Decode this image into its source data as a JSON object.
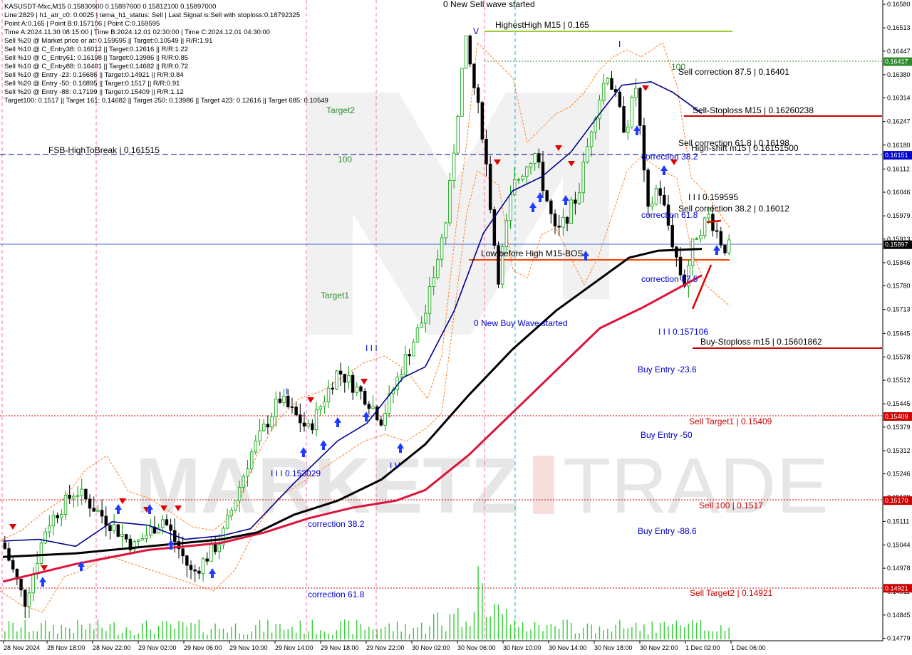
{
  "header": {
    "lines": [
      "KASUSDT-Mxc,M15  0.15830900 0.15897600 0.15812100 0.15897000",
      "Line:2829  |  h1_atr_c0: 0.0025  |  tema_h1_status: Sell  |  Last Signal is:Sell with stoploss:0.18792325",
      "Point A:0.165  |  Point B:0.157106  |  Point C:0.159595",
      "Time A:2024.11.30 08:15:00  |  Time B:2024.12.01 02:30:00  |  Time C:2024.12.01 04:30:00",
      "Sell %20 @ Market price or at: 0.159595  ||  Target:0.10549  ||  R/R:1.91",
      "Sell %10 @ C_Entry38: 0.16012  ||  Target:0.12616  ||  R/R:1.22",
      "Sell %10 @ C_Entry61: 0.16198  ||  Target:0.13986  ||  R/R:0.85",
      "Sell %10 @ C_Entry88: 0.16401  ||  Target:0.14682  ||  R/R:0.72",
      "Sell %10 @ Entry -23: 0.16686  ||  Target:0.14921  ||  R/R:0.84",
      "Sell %20 @ Entry -50: 0.16895  ||  Target:0.1517  ||  R/R:0.91",
      "Sell %20 @ Entry -88: 0.17199  ||  Target:0.15409  ||  R/R:1.12",
      "Target100: 0.1517  ||  Target 161: 0.14682  ||  Target 250: 0.13986  ||  Target 423: 0.12616  ||  Target 685: 0.10549"
    ]
  },
  "watermark": {
    "text_left": "MARKETZ",
    "text_right": "TRADE"
  },
  "colors": {
    "blue_ma": "#00008b",
    "black_ma": "#000000",
    "red_ma": "#dc143c",
    "candle_up": "#00a000",
    "candle_down": "#000000",
    "price_line": "#4169e1",
    "red_level": "#cc0000",
    "green_level": "#9acd32"
  },
  "annotations": [
    {
      "id": "new-sell-wave",
      "text": "0 New Sell wave started",
      "color": "black"
    },
    {
      "id": "highest-high",
      "text": "HighestHigh   M15 | 0.165",
      "color": "black"
    },
    {
      "id": "v-mark",
      "text": "V",
      "color": "blue"
    },
    {
      "id": "i-mark-top",
      "text": "I",
      "color": "blue"
    },
    {
      "id": "hundred-top",
      "text": "100",
      "color": "green"
    },
    {
      "id": "sell-corr-875",
      "text": "Sell correction 87.5 | 0.16401",
      "color": "black"
    },
    {
      "id": "sell-stoploss",
      "text": "Sell-Stoploss M15 | 0.16260238",
      "color": "black"
    },
    {
      "id": "sell-corr-618",
      "text": "Sell correction 61.8 | 0.16198",
      "color": "black"
    },
    {
      "id": "high-shift",
      "text": "High-shift m15 | 0.16151500",
      "color": "black"
    },
    {
      "id": "target2",
      "text": "Target2",
      "color": "green"
    },
    {
      "id": "fsb",
      "text": "FSB-HighToBreak | 0.161515",
      "color": "black"
    },
    {
      "id": "hundred-mid",
      "text": "100",
      "color": "green"
    },
    {
      "id": "corr-382-top",
      "text": "correction 38.2",
      "color": "blue"
    },
    {
      "id": "point-c",
      "text": "I I I 0.159595",
      "color": "black"
    },
    {
      "id": "sell-corr-382",
      "text": "Sell correction 38.2 | 0.16012",
      "color": "black"
    },
    {
      "id": "corr-618-top",
      "text": "correction 61.8",
      "color": "blue"
    },
    {
      "id": "low-before-high",
      "text": "Low before High   M15-BOS",
      "color": "black"
    },
    {
      "id": "corr-875",
      "text": "correction 87.5",
      "color": "blue"
    },
    {
      "id": "target1",
      "text": "Target1",
      "color": "green"
    },
    {
      "id": "new-buy-wave",
      "text": "0 New Buy Wave started",
      "color": "blue"
    },
    {
      "id": "point-b",
      "text": "I I I 0.157106",
      "color": "blue"
    },
    {
      "id": "buy-stoploss",
      "text": "Buy-Stoploss m15 | 0.15601862",
      "color": "black"
    },
    {
      "id": "buy-entry-236",
      "text": "Buy Entry -23.6",
      "color": "blue"
    },
    {
      "id": "iii-mark",
      "text": "I I I",
      "color": "blue"
    },
    {
      "id": "i-mark-left",
      "text": "I",
      "color": "blue"
    },
    {
      "id": "sell-target1",
      "text": "Sell Target1 | 0.15409",
      "color": "red"
    },
    {
      "id": "buy-entry-50",
      "text": "Buy Entry -50",
      "color": "blue"
    },
    {
      "id": "iv-mark",
      "text": "I V",
      "color": "blue"
    },
    {
      "id": "point-low",
      "text": "I I I 0.153029",
      "color": "blue"
    },
    {
      "id": "sell-100",
      "text": "Sell 100 | 0.1517",
      "color": "red"
    },
    {
      "id": "corr-382-low",
      "text": "correction 38.2",
      "color": "blue"
    },
    {
      "id": "buy-entry-886",
      "text": "Buy Entry -88.6",
      "color": "blue"
    },
    {
      "id": "corr-618-low",
      "text": "correction 61.8",
      "color": "blue"
    },
    {
      "id": "sell-target2",
      "text": "Sell Target2 | 0.14921",
      "color": "red"
    }
  ],
  "chart_data": {
    "type": "candlestick",
    "symbol": "KASUSDT-Mxc",
    "timeframe": "M15",
    "ylim": [
      0.1478,
      0.1658
    ],
    "y_ticks": [
      "0.16580",
      "0.16513",
      "0.16447",
      "0.16380",
      "0.16314",
      "0.16247",
      "0.16180",
      "0.16112",
      "0.16046",
      "0.15979",
      "0.15913",
      "0.15846",
      "0.15780",
      "0.15713",
      "0.15645",
      "0.15578",
      "0.15512",
      "0.15445",
      "0.15379",
      "0.15312",
      "0.15246",
      "0.15179",
      "0.15111",
      "0.15044",
      "0.14978",
      "0.14911",
      "0.14845",
      "0.14779"
    ],
    "x_ticks": [
      "28 Nov 2024",
      "28 Nov 18:00",
      "28 Nov 22:00",
      "29 Nov 02:00",
      "29 Nov 06:00",
      "29 Nov 10:00",
      "29 Nov 14:00",
      "29 Nov 18:00",
      "29 Nov 22:00",
      "30 Nov 02:00",
      "30 Nov 06:00",
      "30 Nov 10:00",
      "30 Nov 14:00",
      "30 Nov 18:00",
      "30 Nov 22:00",
      "1 Dec 02:00",
      "1 Dec 06:00"
    ],
    "price_tags": [
      {
        "value": 0.16417,
        "text": "0.16417",
        "color": "#2e8b2e"
      },
      {
        "value": 0.16151,
        "text": "0.16151",
        "color": "#0000cd"
      },
      {
        "value": 0.15897,
        "text": "0.15897",
        "color": "#000000"
      },
      {
        "value": 0.15409,
        "text": "0.15409",
        "color": "#cc0000"
      },
      {
        "value": 0.1517,
        "text": "0.15170",
        "color": "#cc0000"
      },
      {
        "value": 0.14921,
        "text": "0.14921",
        "color": "#cc0000"
      }
    ],
    "levels": [
      {
        "name": "highest-high",
        "value": 0.165,
        "color": "#9acd32",
        "style": "solid"
      },
      {
        "name": "sell-correction-87.5",
        "value": 0.16417,
        "color": "#2e8b2e",
        "style": "dotted"
      },
      {
        "name": "sell-stoploss",
        "value": 0.1626,
        "color": "#cc0000",
        "style": "solid"
      },
      {
        "name": "fsb-high-to-break",
        "value": 0.16151,
        "color": "#00008b",
        "style": "dashed"
      },
      {
        "name": "current-price",
        "value": 0.15897,
        "color": "#4169e1",
        "style": "solid"
      },
      {
        "name": "low-before-high",
        "value": 0.15855,
        "color": "#ff4500",
        "style": "solid"
      },
      {
        "name": "buy-stoploss",
        "value": 0.15602,
        "color": "#cc0000",
        "style": "solid"
      },
      {
        "name": "sell-target1",
        "value": 0.15409,
        "color": "#cc0000",
        "style": "dotted"
      },
      {
        "name": "sell-100",
        "value": 0.1517,
        "color": "#cc0000",
        "style": "dotted"
      },
      {
        "name": "sell-target2",
        "value": 0.14921,
        "color": "#cc0000",
        "style": "dotted"
      }
    ],
    "anchors": {
      "blue_ma": [
        [
          0,
          0.15055
        ],
        [
          0.05,
          0.1506
        ],
        [
          0.1,
          0.1504
        ],
        [
          0.15,
          0.1511
        ],
        [
          0.2,
          0.151
        ],
        [
          0.25,
          0.1506
        ],
        [
          0.3,
          0.1507
        ],
        [
          0.34,
          0.1509
        ],
        [
          0.4,
          0.1522
        ],
        [
          0.46,
          0.1534
        ],
        [
          0.5,
          0.1539
        ],
        [
          0.55,
          0.1552
        ],
        [
          0.58,
          0.1555
        ],
        [
          0.62,
          0.1571
        ],
        [
          0.66,
          0.1593
        ],
        [
          0.7,
          0.1605
        ],
        [
          0.74,
          0.1609
        ],
        [
          0.78,
          0.1616
        ],
        [
          0.82,
          0.1627
        ],
        [
          0.85,
          0.1635
        ],
        [
          0.89,
          0.1636
        ],
        [
          0.92,
          0.1633
        ],
        [
          0.96,
          0.1627
        ]
      ],
      "black_ma": [
        [
          0,
          0.1501
        ],
        [
          0.1,
          0.1502
        ],
        [
          0.2,
          0.1504
        ],
        [
          0.3,
          0.1506
        ],
        [
          0.35,
          0.1508
        ],
        [
          0.4,
          0.1513
        ],
        [
          0.46,
          0.1517
        ],
        [
          0.52,
          0.1523
        ],
        [
          0.58,
          0.1533
        ],
        [
          0.64,
          0.1547
        ],
        [
          0.7,
          0.156
        ],
        [
          0.76,
          0.1571
        ],
        [
          0.82,
          0.158
        ],
        [
          0.86,
          0.1586
        ],
        [
          0.9,
          0.1588
        ],
        [
          0.96,
          0.15885
        ]
      ],
      "red_ma": [
        [
          0,
          0.1494
        ],
        [
          0.1,
          0.1499
        ],
        [
          0.2,
          0.1503
        ],
        [
          0.3,
          0.1505
        ],
        [
          0.36,
          0.1508
        ],
        [
          0.42,
          0.1512
        ],
        [
          0.48,
          0.1515
        ],
        [
          0.54,
          0.1517
        ],
        [
          0.58,
          0.152
        ],
        [
          0.64,
          0.153
        ],
        [
          0.7,
          0.1542
        ],
        [
          0.76,
          0.1554
        ],
        [
          0.82,
          0.1566
        ],
        [
          0.88,
          0.1572
        ],
        [
          0.96,
          0.1581
        ]
      ],
      "price": [
        [
          0,
          0.1505
        ],
        [
          0.03,
          0.1488
        ],
        [
          0.06,
          0.151
        ],
        [
          0.1,
          0.152
        ],
        [
          0.14,
          0.1512
        ],
        [
          0.18,
          0.1504
        ],
        [
          0.22,
          0.1512
        ],
        [
          0.26,
          0.1496
        ],
        [
          0.3,
          0.1506
        ],
        [
          0.34,
          0.153
        ],
        [
          0.38,
          0.1546
        ],
        [
          0.42,
          0.1537
        ],
        [
          0.46,
          0.1554
        ],
        [
          0.5,
          0.1546
        ],
        [
          0.52,
          0.154
        ],
        [
          0.55,
          0.1556
        ],
        [
          0.58,
          0.157
        ],
        [
          0.61,
          0.1598
        ],
        [
          0.635,
          0.1648
        ],
        [
          0.66,
          0.162
        ],
        [
          0.68,
          0.158
        ],
        [
          0.7,
          0.1606
        ],
        [
          0.73,
          0.1616
        ],
        [
          0.76,
          0.1592
        ],
        [
          0.79,
          0.1604
        ],
        [
          0.81,
          0.1625
        ],
        [
          0.83,
          0.1639
        ],
        [
          0.855,
          0.1622
        ],
        [
          0.87,
          0.1635
        ],
        [
          0.885,
          0.1598
        ],
        [
          0.9,
          0.1607
        ],
        [
          0.92,
          0.159
        ],
        [
          0.935,
          0.1578
        ],
        [
          0.95,
          0.1592
        ],
        [
          0.97,
          0.1598
        ],
        [
          0.99,
          0.1589
        ]
      ]
    },
    "candle_count": 180
  }
}
